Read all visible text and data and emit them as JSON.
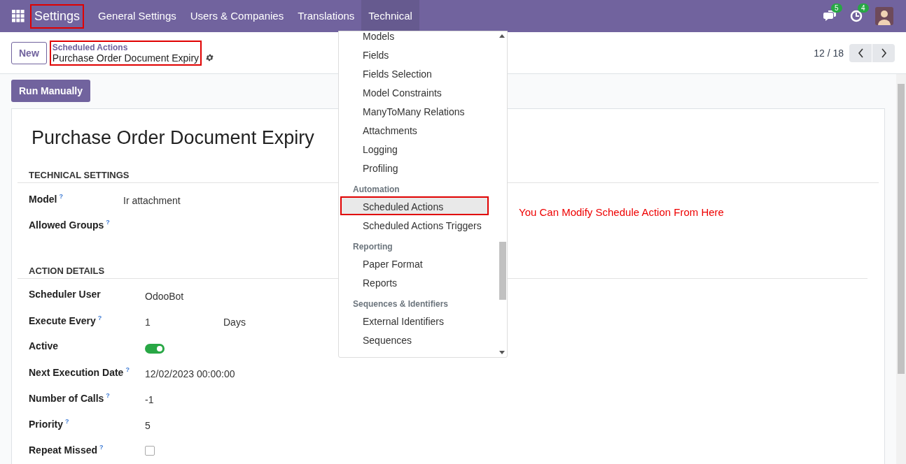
{
  "navbar": {
    "brand": {
      "label": "Settings",
      "highlighted": true
    },
    "menus": [
      {
        "label": "General Settings",
        "selected": false
      },
      {
        "label": "Users & Companies",
        "selected": false
      },
      {
        "label": "Translations",
        "selected": false
      },
      {
        "label": "Technical",
        "selected": true
      }
    ],
    "systray": [
      {
        "kind": "chat",
        "count": "5"
      },
      {
        "kind": "activity",
        "count": "4"
      },
      {
        "kind": "avatar"
      }
    ]
  },
  "control_panel": {
    "new_button": "New",
    "breadcrumb": {
      "parent": "Scheduled Actions",
      "current": "Purchase Order Document Expiry",
      "highlighted": true
    },
    "pager": "12 / 18"
  },
  "run_button": "Run Manually",
  "sheet": {
    "title": "Purchase Order Document Expiry",
    "groups": [
      {
        "title": "TECHNICAL SETTINGS",
        "fields": [
          {
            "label": "Model",
            "help": "?",
            "kind": "text",
            "value": "Ir attachment"
          },
          {
            "label": "Allowed Groups",
            "help": "?",
            "kind": "text"
          }
        ]
      },
      {
        "title": "ACTION DETAILS",
        "fields": [
          {
            "label": "Scheduler User",
            "kind": "text",
            "value": "OdooBot"
          },
          {
            "label": "Execute Every",
            "help": "?",
            "kind": "interval",
            "value": "1",
            "unit": "Days"
          },
          {
            "label": "Active",
            "kind": "toggle",
            "on": true
          },
          {
            "label": "Next Execution Date",
            "help": "?",
            "kind": "text",
            "value": "12/02/2023 00:00:00"
          },
          {
            "label": "Number of Calls",
            "help": "?",
            "kind": "text",
            "value": "-1"
          },
          {
            "label": "Priority",
            "help": "?",
            "kind": "text",
            "value": "5"
          },
          {
            "label": "Repeat Missed",
            "help": "?",
            "kind": "checkbox",
            "checked": false
          }
        ]
      }
    ]
  },
  "dropdown": {
    "items": [
      {
        "kind": "item",
        "label": "Models",
        "selected": false,
        "highlighted": false
      },
      {
        "kind": "item",
        "label": "Fields",
        "selected": false,
        "highlighted": false
      },
      {
        "kind": "item",
        "label": "Fields Selection",
        "selected": false,
        "highlighted": false
      },
      {
        "kind": "item",
        "label": "Model Constraints",
        "selected": false,
        "highlighted": false
      },
      {
        "kind": "item",
        "label": "ManyToMany Relations",
        "selected": false,
        "highlighted": false
      },
      {
        "kind": "item",
        "label": "Attachments",
        "selected": false,
        "highlighted": false
      },
      {
        "kind": "item",
        "label": "Logging",
        "selected": false,
        "highlighted": false
      },
      {
        "kind": "item",
        "label": "Profiling",
        "selected": false,
        "highlighted": false
      },
      {
        "kind": "section",
        "label": "Automation"
      },
      {
        "kind": "item",
        "label": "Scheduled Actions",
        "selected": true,
        "highlighted": true
      },
      {
        "kind": "item",
        "label": "Scheduled Actions Triggers",
        "selected": false,
        "highlighted": false
      },
      {
        "kind": "section",
        "label": "Reporting"
      },
      {
        "kind": "item",
        "label": "Paper Format",
        "selected": false,
        "highlighted": false
      },
      {
        "kind": "item",
        "label": "Reports",
        "selected": false,
        "highlighted": false
      },
      {
        "kind": "section",
        "label": "Sequences & Identifiers"
      },
      {
        "kind": "item",
        "label": "External Identifiers",
        "selected": false,
        "highlighted": false
      },
      {
        "kind": "item",
        "label": "Sequences",
        "selected": false,
        "highlighted": false
      }
    ]
  },
  "annotation": "You Can Modify Schedule Action From Here"
}
